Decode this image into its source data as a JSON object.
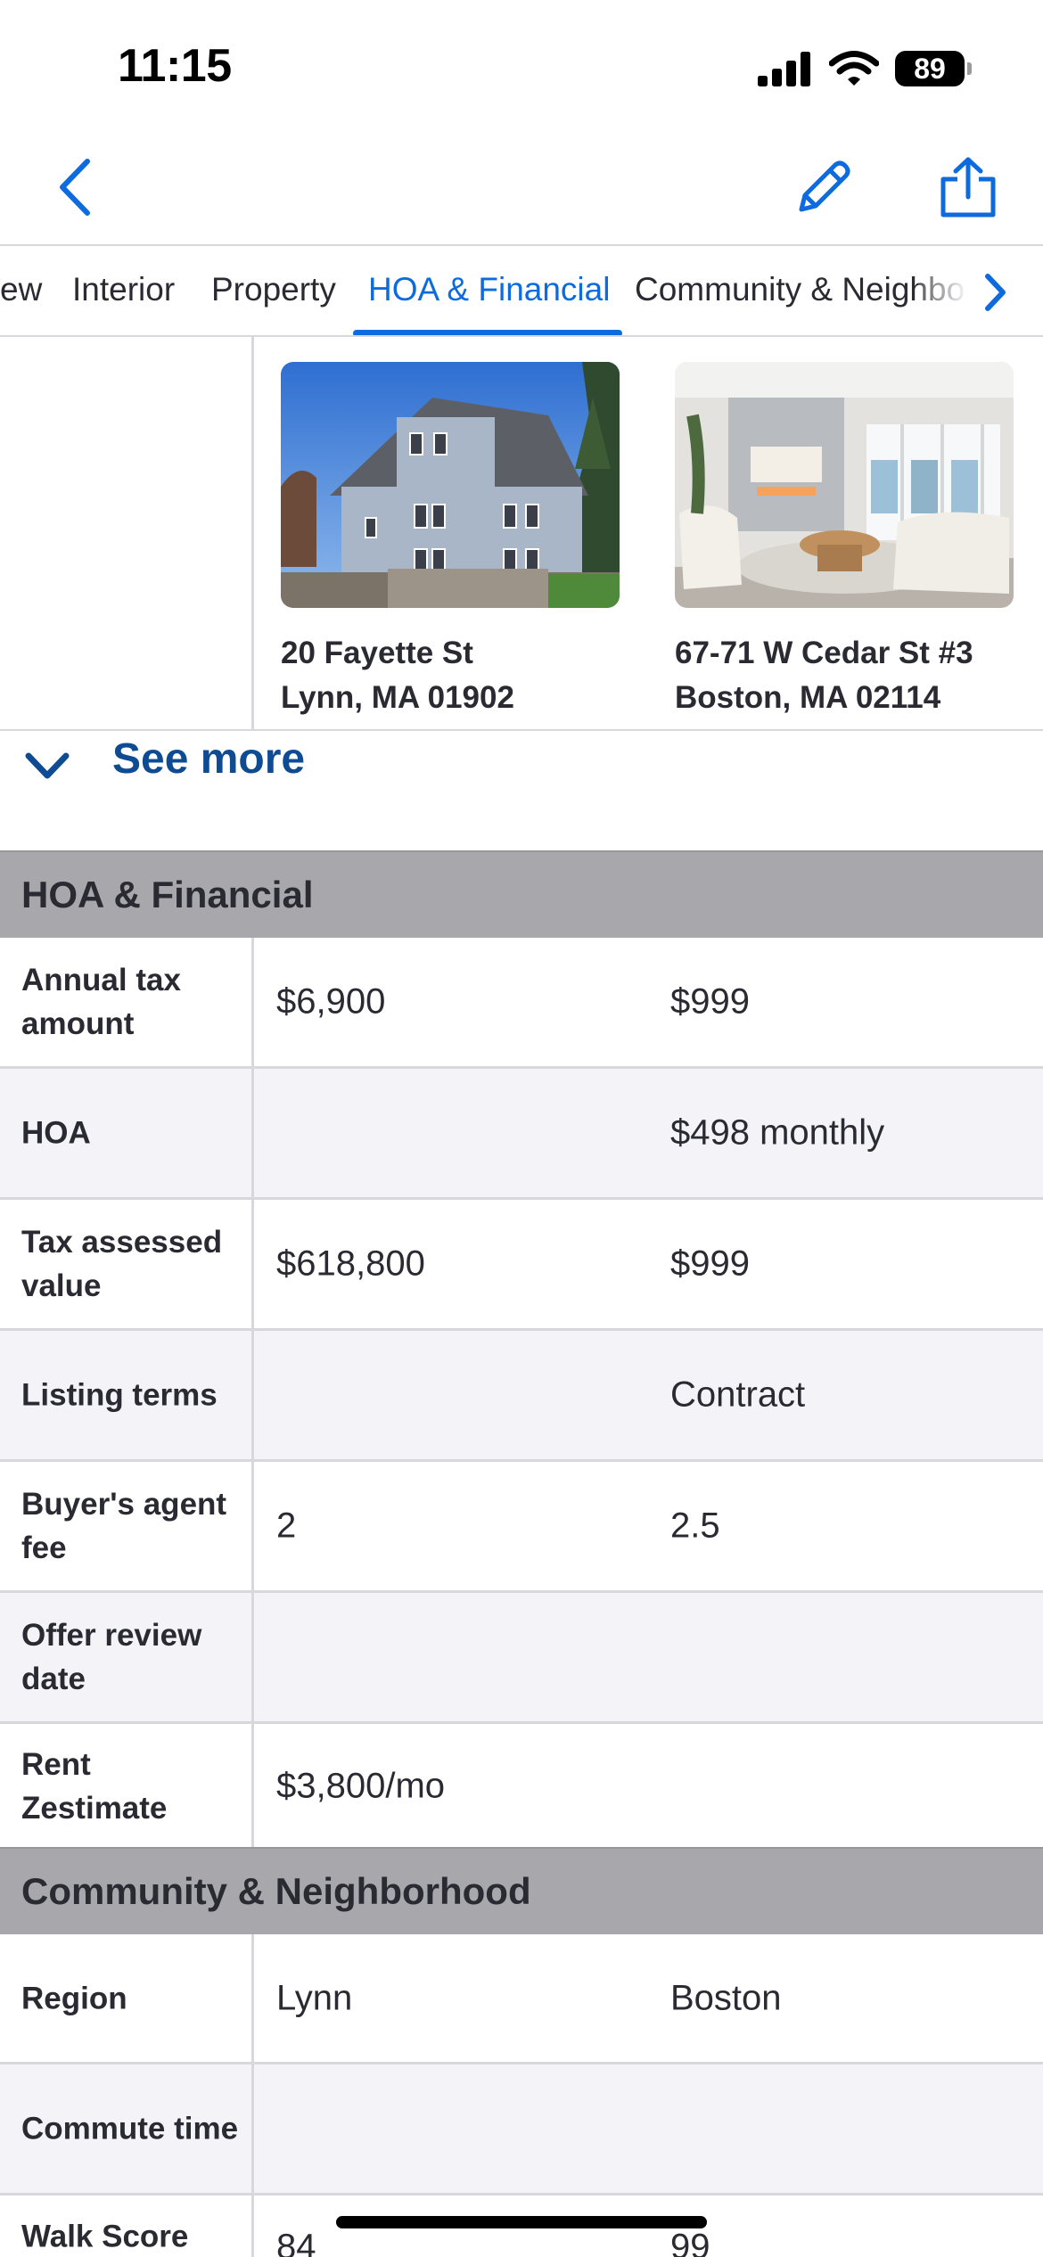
{
  "status_bar": {
    "time": "11:15",
    "battery": "89"
  },
  "nav": {
    "back_icon": "chevron-left-icon",
    "edit_icon": "pencil-icon",
    "share_icon": "share-icon",
    "accent": "#0d6bde"
  },
  "tabs": {
    "items": [
      {
        "label": "ew"
      },
      {
        "label": "Interior"
      },
      {
        "label": "Property"
      },
      {
        "label": "HOA & Financial",
        "active": true
      },
      {
        "label": "Community & Neighborhood"
      }
    ],
    "next_icon": "chevron-right-icon"
  },
  "homes": [
    {
      "address_line1": "20 Fayette St",
      "address_line2": "Lynn, MA 01902",
      "photo": "house-exterior-photo"
    },
    {
      "address_line1": "67-71 W Cedar St #3",
      "address_line2": "Boston, MA 02114",
      "photo": "living-room-photo"
    }
  ],
  "see_more": {
    "label": "See more",
    "icon": "chevron-down-icon",
    "color": "#0e4b93"
  },
  "sections": [
    {
      "title": "HOA & Financial",
      "rows": [
        {
          "label": "Annual tax amount",
          "values": [
            "$6,900",
            "$999"
          ]
        },
        {
          "label": "HOA",
          "values": [
            "",
            "$498 monthly"
          ]
        },
        {
          "label": "Tax assessed value",
          "values": [
            "$618,800",
            "$999"
          ]
        },
        {
          "label": "Listing terms",
          "values": [
            "",
            "Contract"
          ]
        },
        {
          "label": "Buyer's agent fee",
          "values": [
            "2",
            "2.5"
          ]
        },
        {
          "label": "Offer review date",
          "values": [
            "",
            ""
          ]
        },
        {
          "label": "Rent Zestimate",
          "values": [
            "$3,800/mo",
            ""
          ]
        }
      ]
    },
    {
      "title": "Community & Neighborhood",
      "rows": [
        {
          "label": "Region",
          "values": [
            "Lynn",
            "Boston"
          ]
        },
        {
          "label": "Commute time",
          "values": [
            "",
            ""
          ]
        },
        {
          "label": "Walk Score",
          "values": [
            "84",
            "99"
          ]
        }
      ]
    }
  ]
}
